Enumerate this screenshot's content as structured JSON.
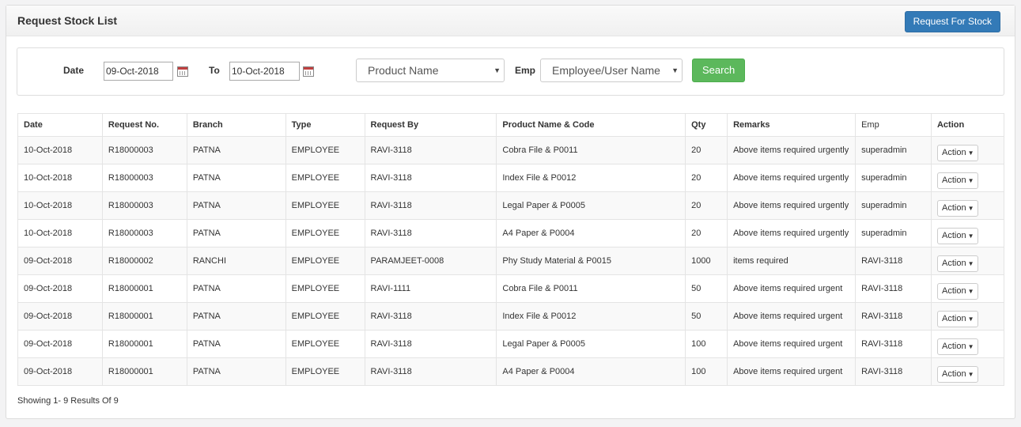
{
  "header": {
    "title": "Request Stock List",
    "request_button": "Request For Stock"
  },
  "filter": {
    "date_label": "Date",
    "date_from": "09-Oct-2018",
    "to_label": "To",
    "date_to": "10-Oct-2018",
    "product_placeholder": "Product Name",
    "emp_label": "Emp",
    "emp_placeholder": "Employee/User Name",
    "search_button": "Search",
    "calendar_icon": "calendar-icon",
    "dropdown_icon": "caret-down-icon"
  },
  "table": {
    "columns": [
      "Date",
      "Request No.",
      "Branch",
      "Type",
      "Request By",
      "Product Name & Code",
      "Qty",
      "Remarks",
      "Emp",
      "Action"
    ],
    "rows": [
      [
        "10-Oct-2018",
        "R18000003",
        "PATNA",
        "EMPLOYEE",
        "RAVI-3118",
        "Cobra File & P0011",
        "20",
        "Above items required urgently",
        "superadmin",
        "Action"
      ],
      [
        "10-Oct-2018",
        "R18000003",
        "PATNA",
        "EMPLOYEE",
        "RAVI-3118",
        "Index File & P0012",
        "20",
        "Above items required urgently",
        "superadmin",
        "Action"
      ],
      [
        "10-Oct-2018",
        "R18000003",
        "PATNA",
        "EMPLOYEE",
        "RAVI-3118",
        "Legal Paper & P0005",
        "20",
        "Above items required urgently",
        "superadmin",
        "Action"
      ],
      [
        "10-Oct-2018",
        "R18000003",
        "PATNA",
        "EMPLOYEE",
        "RAVI-3118",
        "A4 Paper & P0004",
        "20",
        "Above items required urgently",
        "superadmin",
        "Action"
      ],
      [
        "09-Oct-2018",
        "R18000002",
        "RANCHI",
        "EMPLOYEE",
        "PARAMJEET-0008",
        "Phy Study Material & P0015",
        "1000",
        "items required",
        "RAVI-3118",
        "Action"
      ],
      [
        "09-Oct-2018",
        "R18000001",
        "PATNA",
        "EMPLOYEE",
        "RAVI-1111",
        "Cobra File & P0011",
        "50",
        "Above items required urgent",
        "RAVI-3118",
        "Action"
      ],
      [
        "09-Oct-2018",
        "R18000001",
        "PATNA",
        "EMPLOYEE",
        "RAVI-3118",
        "Index File & P0012",
        "50",
        "Above items required urgent",
        "RAVI-3118",
        "Action"
      ],
      [
        "09-Oct-2018",
        "R18000001",
        "PATNA",
        "EMPLOYEE",
        "RAVI-3118",
        "Legal Paper & P0005",
        "100",
        "Above items required urgent",
        "RAVI-3118",
        "Action"
      ],
      [
        "09-Oct-2018",
        "R18000001",
        "PATNA",
        "EMPLOYEE",
        "RAVI-3118",
        "A4 Paper & P0004",
        "100",
        "Above items required urgent",
        "RAVI-3118",
        "Action"
      ]
    ]
  },
  "footer": {
    "showing_text": "Showing 1- 9 Results Of 9"
  }
}
